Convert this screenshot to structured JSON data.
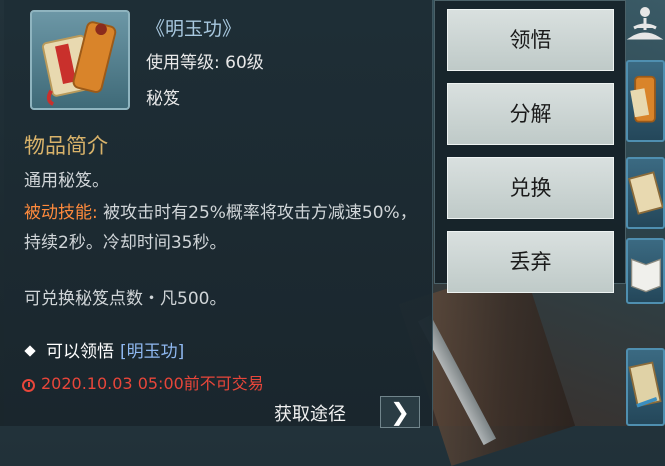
{
  "item": {
    "title": "《明玉功》",
    "level": "使用等级: 60级",
    "type": "秘笈"
  },
  "description": {
    "section_title": "物品简介",
    "line1": "通用秘笈。",
    "skill_label": "被动技能:",
    "skill_text": "被攻击时有25%概率将攻击方减速50%，持续2秒。冷却时间35秒。",
    "exchange_text": "可兑换秘笈点数・凡500。"
  },
  "learn": {
    "text": "可以领悟",
    "link": "[明玉功]"
  },
  "trade_restriction": "2020.10.03 05:00前不可交易",
  "source": {
    "label": "获取途径",
    "arrow": "❯"
  },
  "actions": [
    "领悟",
    "分解",
    "兑换",
    "丢弃"
  ],
  "side_icons": [
    "meditation-icon",
    "scroll-icon",
    "book-icon",
    "open-book-icon",
    "manual-icon"
  ]
}
